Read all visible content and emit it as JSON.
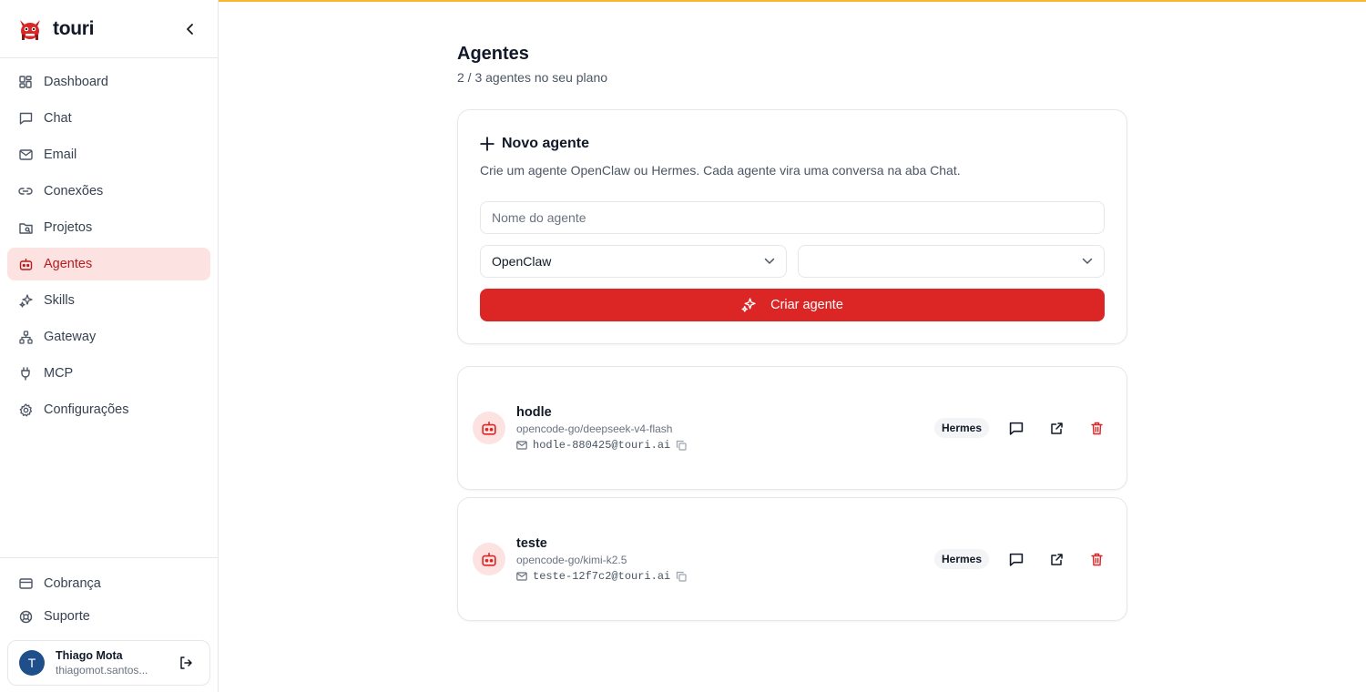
{
  "brand": {
    "name": "touri"
  },
  "sidebar": {
    "items": [
      {
        "label": "Dashboard",
        "icon": "dashboard-icon"
      },
      {
        "label": "Chat",
        "icon": "chat-icon"
      },
      {
        "label": "Email",
        "icon": "mail-icon"
      },
      {
        "label": "Conexões",
        "icon": "link-icon"
      },
      {
        "label": "Projetos",
        "icon": "folder-icon"
      },
      {
        "label": "Agentes",
        "icon": "bot-icon",
        "active": true
      },
      {
        "label": "Skills",
        "icon": "sparkles-icon"
      },
      {
        "label": "Gateway",
        "icon": "network-icon"
      },
      {
        "label": "MCP",
        "icon": "plug-icon"
      },
      {
        "label": "Configurações",
        "icon": "gear-icon"
      }
    ],
    "bottom": [
      {
        "label": "Cobrança",
        "icon": "credit-card-icon"
      },
      {
        "label": "Suporte",
        "icon": "lifebuoy-icon"
      }
    ],
    "user": {
      "initial": "T",
      "name": "Thiago Mota",
      "email": "thiagomot.santos..."
    }
  },
  "page": {
    "title": "Agentes",
    "subtitle": "2 / 3 agentes no seu plano"
  },
  "create": {
    "title": "Novo agente",
    "description": "Crie um agente OpenClaw ou Hermes. Cada agente vira uma conversa na aba Chat.",
    "name_placeholder": "Nome do agente",
    "name_value": "",
    "runtime_value": "OpenClaw",
    "model_value": "",
    "button_label": "Criar agente"
  },
  "agents": [
    {
      "name": "hodle",
      "model": "opencode-go/deepseek-v4-flash",
      "email": "hodle-880425@touri.ai",
      "runtime": "Hermes"
    },
    {
      "name": "teste",
      "model": "opencode-go/kimi-k2.5",
      "email": "teste-12f7c2@touri.ai",
      "runtime": "Hermes"
    }
  ],
  "colors": {
    "accent": "#dc2626",
    "active_bg": "#fde2e2",
    "top_accent": "#f5b82e",
    "avatar_bg": "#1e4f8a"
  }
}
